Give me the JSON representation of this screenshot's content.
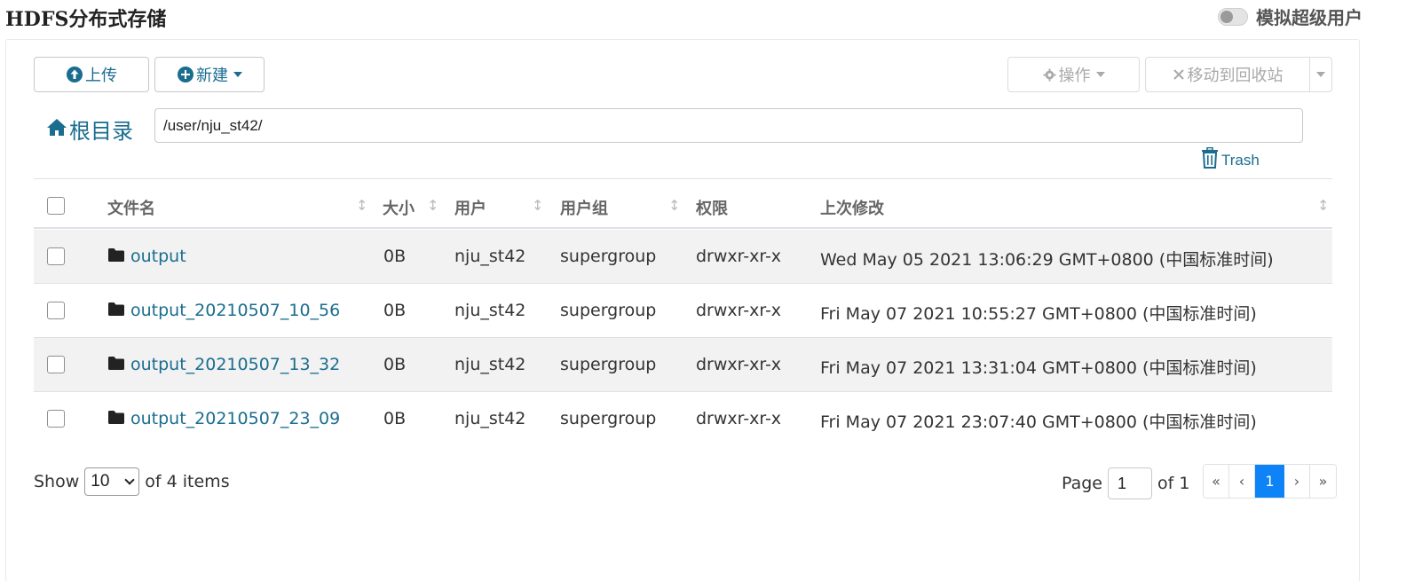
{
  "title": "HDFS分布式存储",
  "superuser": {
    "label": "模拟超级用户",
    "enabled": false
  },
  "toolbar": {
    "upload": "上传",
    "new": "新建",
    "actions": "操作",
    "move_to_trash": "移动到回收站"
  },
  "path_bar": {
    "root": "根目录",
    "path": "/user/nju_st42/"
  },
  "trash": "Trash",
  "table": {
    "headers": [
      "文件名",
      "大小",
      "用户",
      "用户组",
      "权限",
      "上次修改"
    ],
    "rows": [
      {
        "name": "output",
        "size": "0B",
        "user": "nju_st42",
        "group": "supergroup",
        "perm": "drwxr-xr-x",
        "modified": "Wed May 05 2021 13:06:29 GMT+0800 (中国标准时间)"
      },
      {
        "name": "output_20210507_10_56",
        "size": "0B",
        "user": "nju_st42",
        "group": "supergroup",
        "perm": "drwxr-xr-x",
        "modified": "Fri May 07 2021 10:55:27 GMT+0800 (中国标准时间)"
      },
      {
        "name": "output_20210507_13_32",
        "size": "0B",
        "user": "nju_st42",
        "group": "supergroup",
        "perm": "drwxr-xr-x",
        "modified": "Fri May 07 2021 13:31:04 GMT+0800 (中国标准时间)"
      },
      {
        "name": "output_20210507_23_09",
        "size": "0B",
        "user": "nju_st42",
        "group": "supergroup",
        "perm": "drwxr-xr-x",
        "modified": "Fri May 07 2021 23:07:40 GMT+0800 (中国标准时间)"
      }
    ]
  },
  "footer": {
    "show": "Show",
    "page_size": "10",
    "of_items": "of 4 items",
    "page": "Page",
    "current_page": "1",
    "of_pages": "of 1",
    "pager": [
      "«",
      "‹",
      "1",
      "›",
      "»"
    ]
  },
  "colors": {
    "link": "#1a6d8f",
    "active_page": "#0d83f7",
    "stripe": "#f2f2f2"
  }
}
